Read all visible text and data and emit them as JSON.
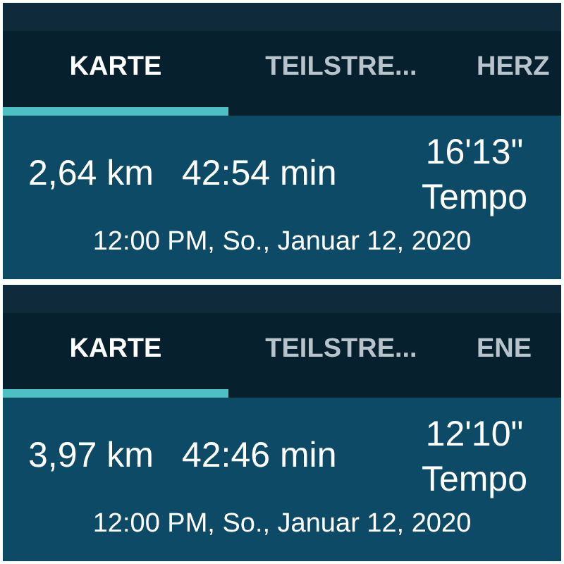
{
  "panels": [
    {
      "tabs": [
        {
          "label": "KARTE",
          "selected": true
        },
        {
          "label": "TEILSTRE...",
          "selected": false
        },
        {
          "label": "HERZ",
          "selected": false
        }
      ],
      "distance": "2,64 km",
      "duration": "42:54 min",
      "pace": "16'13\"",
      "pace_label": "Tempo",
      "date": "12:00 PM, So., Januar 12, 2020"
    },
    {
      "tabs": [
        {
          "label": "KARTE",
          "selected": true
        },
        {
          "label": "TEILSTRE...",
          "selected": false
        },
        {
          "label": "ENE",
          "selected": false
        }
      ],
      "distance": "3,97 km",
      "duration": "42:46 min",
      "pace": "12'10\"",
      "pace_label": "Tempo",
      "date": "12:00 PM, So., Januar 12, 2020"
    }
  ]
}
